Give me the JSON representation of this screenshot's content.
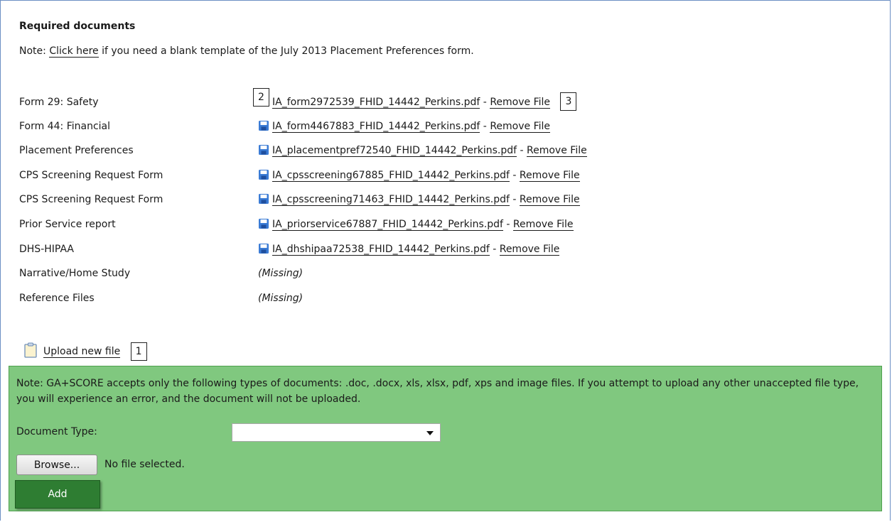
{
  "section": {
    "title": "Required documents",
    "note_prefix": "Note: ",
    "note_link": "Click here",
    "note_suffix": " if you need a blank template of the July 2013 Placement Preferences form."
  },
  "documents": [
    {
      "label": "Form 29: Safety",
      "file": "IA_form2972539_FHID_14442_Perkins.pdf",
      "separator": " - ",
      "action": "Remove File"
    },
    {
      "label": "Form 44: Financial",
      "file": "IA_form4467883_FHID_14442_Perkins.pdf",
      "separator": " - ",
      "action": "Remove File"
    },
    {
      "label": "Placement Preferences",
      "file": "IA_placementpref72540_FHID_14442_Perkins.pdf",
      "separator": " - ",
      "action": "Remove File"
    },
    {
      "label": "CPS Screening Request Form",
      "file": "IA_cpsscreening67885_FHID_14442_Perkins.pdf",
      "separator": " - ",
      "action": "Remove File"
    },
    {
      "label": "CPS Screening Request Form",
      "file": "IA_cpsscreening71463_FHID_14442_Perkins.pdf",
      "separator": " - ",
      "action": "Remove File"
    },
    {
      "label": "Prior Service report",
      "file": "IA_priorservice67887_FHID_14442_Perkins.pdf",
      "separator": " - ",
      "action": "Remove File"
    },
    {
      "label": "DHS-HIPAA",
      "file": "IA_dhshipaa72538_FHID_14442_Perkins.pdf",
      "separator": " - ",
      "action": "Remove File"
    },
    {
      "label": "Narrative/Home Study",
      "missing": "(Missing)"
    },
    {
      "label": "Reference Files",
      "missing": "(Missing)"
    }
  ],
  "callouts": {
    "one": "1",
    "two": "2",
    "three": "3"
  },
  "upload": {
    "label": "Upload new file"
  },
  "upload_form": {
    "note": "Note: GA+SCORE accepts only the following types of documents: .doc, .docx, xls, xlsx, pdf, xps and image files. If you attempt to upload any other unaccepted file type, you will experience an error, and the document will not be uploaded.",
    "doctype_label": "Document Type:",
    "doctype_value": "",
    "browse_label": "Browse...",
    "no_file_text": "No file selected.",
    "add_label": "Add"
  },
  "icons": {
    "file": "floppy-disk-icon",
    "upload": "clipboard-icon"
  },
  "colors": {
    "panel_bg": "#80c87f",
    "add_button": "#2e7d32",
    "frame_border": "#6b8fc4"
  }
}
